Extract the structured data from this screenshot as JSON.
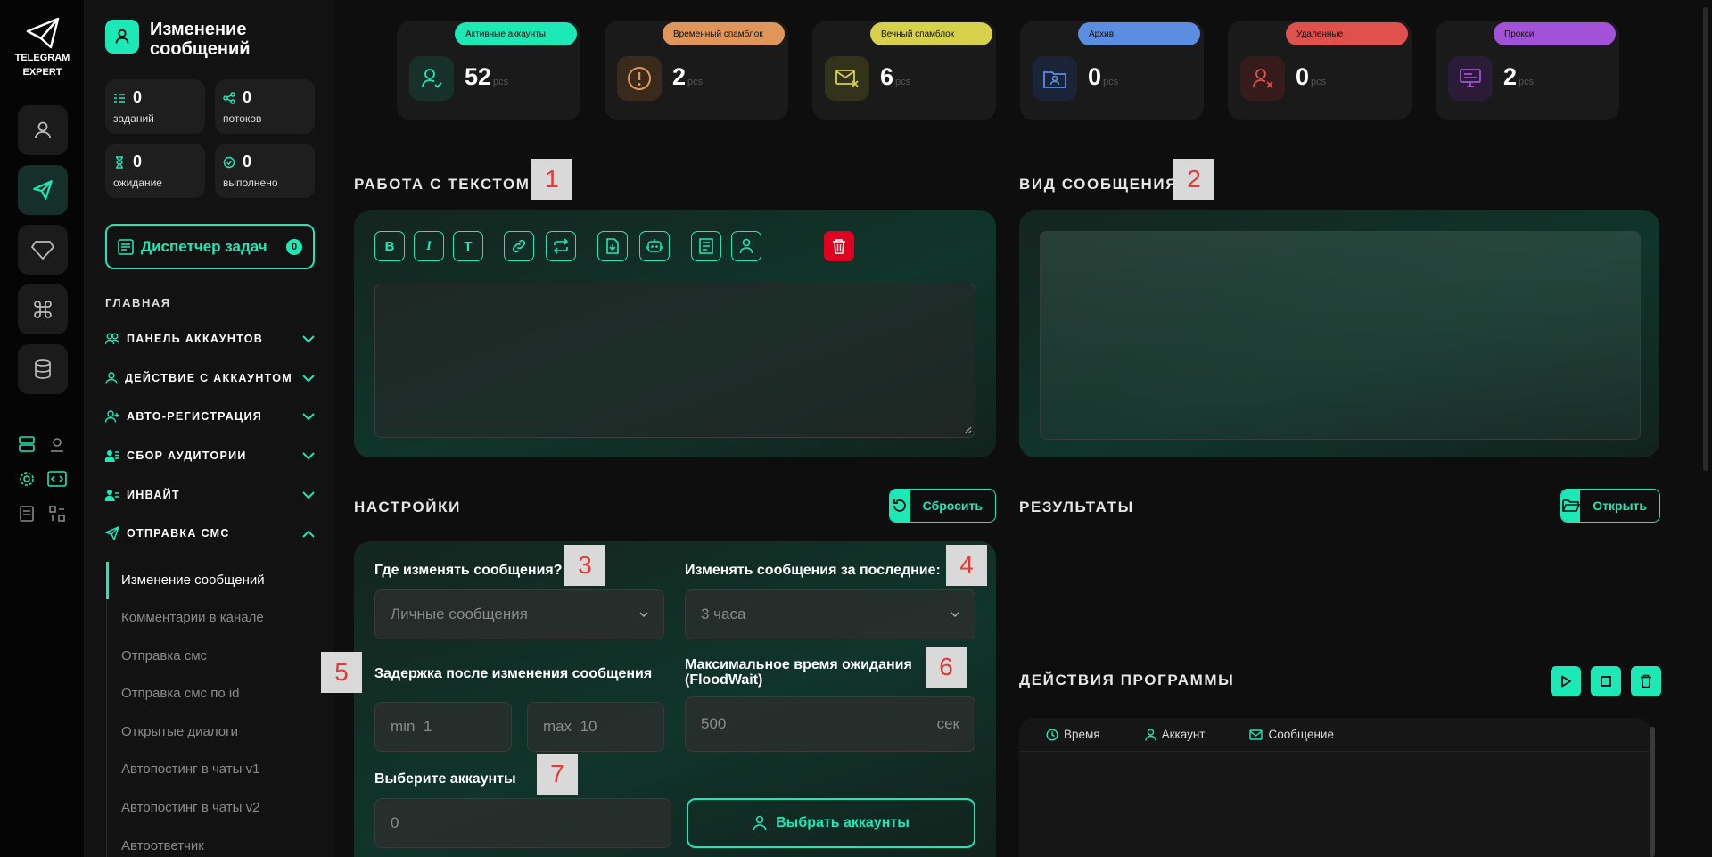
{
  "app": {
    "logo_line1": "TELEGRAM",
    "logo_line2": "EXPERT",
    "accent": "#1de9b6"
  },
  "sidebar": {
    "title": "Изменение сообщений",
    "stats": [
      {
        "value": "0",
        "label": "заданий",
        "icon": "tasks-icon"
      },
      {
        "value": "0",
        "label": "потоков",
        "icon": "share-icon"
      },
      {
        "value": "0",
        "label": "ожидание",
        "icon": "hourglass-icon"
      },
      {
        "value": "0",
        "label": "выполнено",
        "icon": "check-circle-icon"
      }
    ],
    "dispatcher_label": "Диспетчер задач",
    "dispatcher_count": "0",
    "section_label": "ГЛАВНАЯ",
    "nav": [
      {
        "label": "ПАНЕЛЬ АККАУНТОВ",
        "icon": "users-icon"
      },
      {
        "label": "ДЕЙСТВИЕ С АККАУНТОМ",
        "icon": "user-icon"
      },
      {
        "label": "АВТО-РЕГИСТРАЦИЯ",
        "icon": "user-plus-icon"
      },
      {
        "label": "СБОР АУДИТОРИИ",
        "icon": "user-list-icon"
      },
      {
        "label": "ИНВАЙТ",
        "icon": "user-invite-icon"
      },
      {
        "label": "ОТПРАВКА СМС",
        "icon": "send-icon"
      }
    ],
    "sub_items": [
      "Изменение сообщений",
      "Комментарии в канале",
      "Отправка смс",
      "Отправка смс по id",
      "Открытые диалоги",
      "Автопостинг в чаты v1",
      "Автопостинг в чаты v2",
      "Автоответчик"
    ]
  },
  "cards": [
    {
      "label": "Активные аккаунты",
      "value": "52",
      "unit": "pcs",
      "color": "#1de9b6",
      "icon": "user-check-icon"
    },
    {
      "label": "Временный спамблок",
      "value": "2",
      "unit": "pcs",
      "color": "#e0955a",
      "icon": "alert-icon"
    },
    {
      "label": "Вечный спамблок",
      "value": "6",
      "unit": "pcs",
      "color": "#d6d04a",
      "icon": "mail-block-icon"
    },
    {
      "label": "Архив",
      "value": "0",
      "unit": "pcs",
      "color": "#5b8de0",
      "icon": "archive-user-icon"
    },
    {
      "label": "Удаленные",
      "value": "0",
      "unit": "pcs",
      "color": "#e0504c",
      "icon": "user-x-icon"
    },
    {
      "label": "Прокси",
      "value": "2",
      "unit": "pcs",
      "color": "#a251d9",
      "icon": "proxy-icon"
    }
  ],
  "text_panel": {
    "title": "РАБОТА С ТЕКСТОМ",
    "marker": "1"
  },
  "toolbar": {
    "bold": "B",
    "italic": "I",
    "text": "T"
  },
  "preview_panel": {
    "title": "ВИД СООБЩЕНИЯ",
    "marker": "2"
  },
  "settings": {
    "title": "НАСТРОЙКИ",
    "reset_label": "Сбросить",
    "where_label": "Где изменять сообщения?",
    "where_value": "Личные сообщения",
    "period_label": "Изменять сообщения за последние:",
    "period_value": "3 часа",
    "delay_label": "Задержка после изменения сообщения",
    "delay_min_prefix": "min",
    "delay_min": "1",
    "delay_max_prefix": "max",
    "delay_max": "10",
    "floodwait_label": "Максимальное время ожидания (FloodWait)",
    "floodwait_value": "500",
    "floodwait_unit": "сек",
    "accounts_label": "Выберите аккаунты",
    "accounts_value": "0",
    "select_accounts_label": "Выбрать аккаунты",
    "markers": [
      "3",
      "4",
      "5",
      "6",
      "7"
    ]
  },
  "results": {
    "title": "РЕЗУЛЬТАТЫ",
    "open_label": "Открыть"
  },
  "actions": {
    "title": "ДЕЙСТВИЯ ПРОГРАММЫ",
    "columns": [
      "Время",
      "Аккаунт",
      "Сообщение"
    ]
  }
}
